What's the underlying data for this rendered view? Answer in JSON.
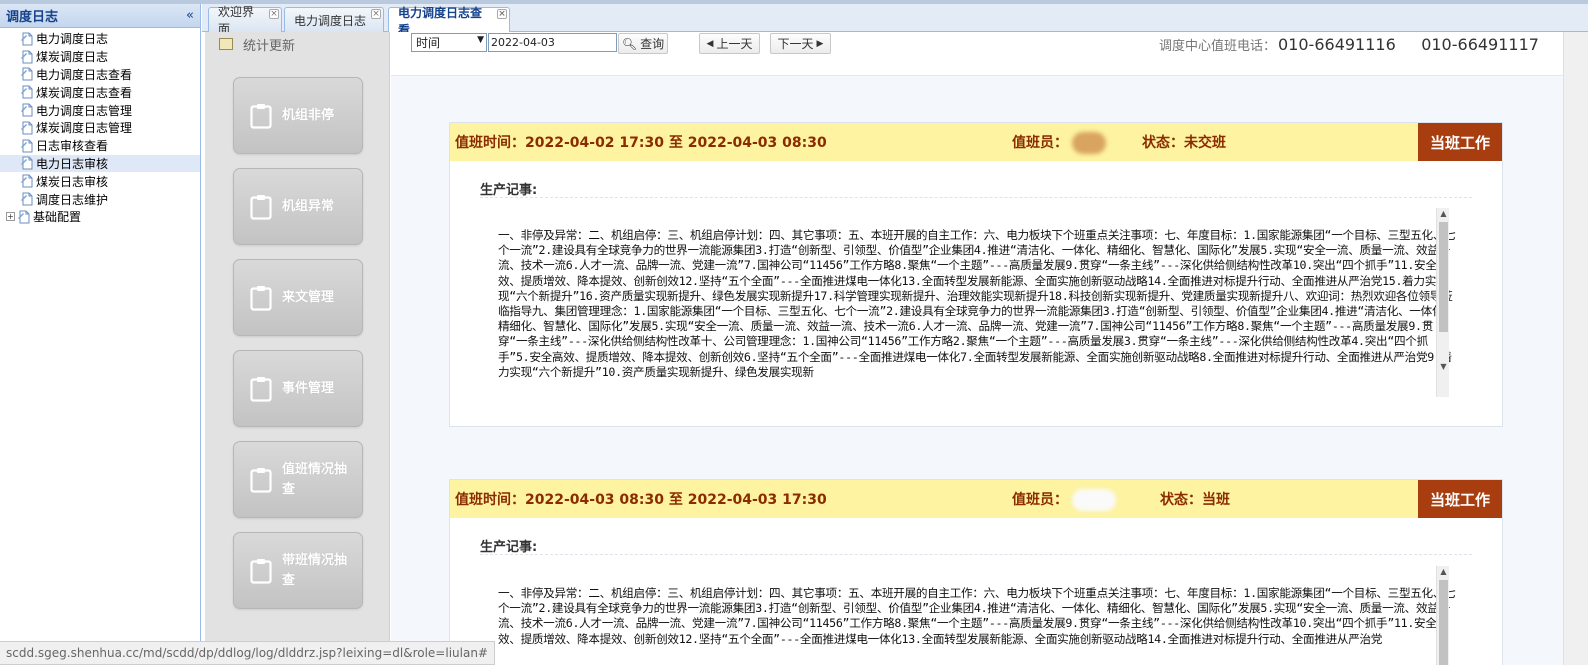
{
  "left_panel": {
    "title": "调度日志",
    "collapse_glyph": "«",
    "items": [
      {
        "label": "电力调度日志",
        "selected": false
      },
      {
        "label": "煤炭调度日志",
        "selected": false
      },
      {
        "label": "电力调度日志查看",
        "selected": false
      },
      {
        "label": "煤炭调度日志查看",
        "selected": false
      },
      {
        "label": "电力调度日志管理",
        "selected": false
      },
      {
        "label": "煤炭调度日志管理",
        "selected": false
      },
      {
        "label": "日志审核查看",
        "selected": false
      },
      {
        "label": "电力日志审核",
        "selected": true
      },
      {
        "label": "煤炭日志审核",
        "selected": false
      },
      {
        "label": "调度日志维护",
        "selected": false
      }
    ],
    "root_item": {
      "label": "基础配置",
      "expander": "+"
    }
  },
  "tabs": [
    {
      "label": "欢迎界面",
      "active": false,
      "close": "×"
    },
    {
      "label": "电力调度日志",
      "active": false,
      "close": "×"
    },
    {
      "label": "电力调度日志查看",
      "active": true,
      "close": "×"
    }
  ],
  "side_menu": {
    "update_label": "统计更新",
    "buttons": [
      {
        "label": "机组非停",
        "icon": "clipboard-icon"
      },
      {
        "label": "机组异常",
        "icon": "clipboard-icon"
      },
      {
        "label": "来文管理",
        "icon": "clipboard-icon"
      },
      {
        "label": "事件管理",
        "icon": "clipboard-icon"
      },
      {
        "label": "值班情况抽查",
        "icon": "clipboard-icon"
      },
      {
        "label": "带班情况抽查",
        "icon": "clipboard-icon"
      }
    ]
  },
  "toolbar": {
    "filter_select": "时间",
    "date_value": "2022-04-03",
    "search_label": "查询",
    "prev_label": "上一天",
    "next_label": "下一天",
    "hotline_label": "调度中心值班电话：",
    "hotline_numbers": "010-66491116     010-66491117"
  },
  "cards": [
    {
      "duty_time": "值班时间：2022-04-02 17:30 至 2022-04-03 08:30",
      "duty_person_label": "值班员：",
      "status": "状态：未交班",
      "work_button": "当班工作",
      "section_label": "生产记事:",
      "content": "一、非停及异常：二、机组启停：三、机组启停计划：四、其它事项：五、本班开展的自主工作：六、电力板块下个班重点关注事项：七、年度目标：1.国家能源集团“一个目标、三型五化、七个一流”2.建设具有全球竞争力的世界一流能源集团3.打造“创新型、引领型、价值型”企业集团4.推进“清洁化、一体化、精细化、智慧化、国际化”发展5.实现“安全一流、质量一流、效益一流、技术一流6.人才一流、品牌一流、党建一流”7.国神公司“11456”工作方略8.聚焦“一个主题”---高质量发展9.贯穿“一条主线”---深化供给侧结构性改革10.突出“四个抓手”11.安全高效、提质增效、降本提效、创新创效12.坚持“五个全面”---全面推进煤电一体化13.全面转型发展新能源、全面实施创新驱动战略14.全面推进对标提升行动、全面推进从严治党15.着力实现“六个新提升”16.资产质量实现新提升、绿色发展实现新提升17.科学管理实现新提升、治理效能实现新提升18.科技创新实现新提升、党建质量实现新提升八、欢迎词：热烈欢迎各位领导莅临指导九、集团管理理念：1.国家能源集团“一个目标、三型五化、七个一流”2.建设具有全球竞争力的世界一流能源集团3.打造“创新型、引领型、价值型”企业集团4.推进“清洁化、一体化、精细化、智慧化、国际化”发展5.实现“安全一流、质量一流、效益一流、技术一流6.人才一流、品牌一流、党建一流”7.国神公司“11456”工作方略8.聚焦“一个主题”---高质量发展9.贯穿“一条主线”---深化供给侧结构性改革十、公司管理理念：1.国神公司“11456”工作方略2.聚焦“一个主题”---高质量发展3.贯穿“一条主线”---深化供给侧结构性改革4.突出“四个抓手”5.安全高效、提质增效、降本提效、创新创效6.坚持“五个全面”---全面推进煤电一体化7.全面转型发展新能源、全面实施创新驱动战略8.全面推进对标提升行动、全面推进从严治党9.着力实现“六个新提升”10.资产质量实现新提升、绿色发展实现新"
    },
    {
      "duty_time": "值班时间：2022-04-03 08:30 至 2022-04-03 17:30",
      "duty_person_label": "值班员：",
      "status": "状态：当班",
      "work_button": "当班工作",
      "section_label": "生产记事:",
      "content": "一、非停及异常：二、机组启停：三、机组启停计划：四、其它事项：五、本班开展的自主工作：六、电力板块下个班重点关注事项：七、年度目标：1.国家能源集团“一个目标、三型五化、七个一流”2.建设具有全球竞争力的世界一流能源集团3.打造“创新型、引领型、价值型”企业集团4.推进“清洁化、一体化、精细化、智慧化、国际化”发展5.实现“安全一流、质量一流、效益一流、技术一流6.人才一流、品牌一流、党建一流”7.国神公司“11456”工作方略8.聚焦“一个主题”---高质量发展9.贯穿“一条主线”---深化供给侧结构性改革10.突出“四个抓手”11.安全高效、提质增效、降本提效、创新创效12.坚持“五个全面”---全面推进煤电一体化13.全面转型发展新能源、全面实施创新驱动战略14.全面推进对标提升行动、全面推进从严治党"
    }
  ],
  "status_bar": {
    "url": "scdd.sgeg.shenhua.cc/md/scdd/dp/ddlog/log/dlddrz.jsp?leixing=dl&role=liulan#"
  },
  "colors": {
    "card_header_bg": "#fdf3a1",
    "card_header_text": "#8b2b00",
    "work_button_bg": "#a83d10",
    "tree_header_text": "#15428b"
  }
}
